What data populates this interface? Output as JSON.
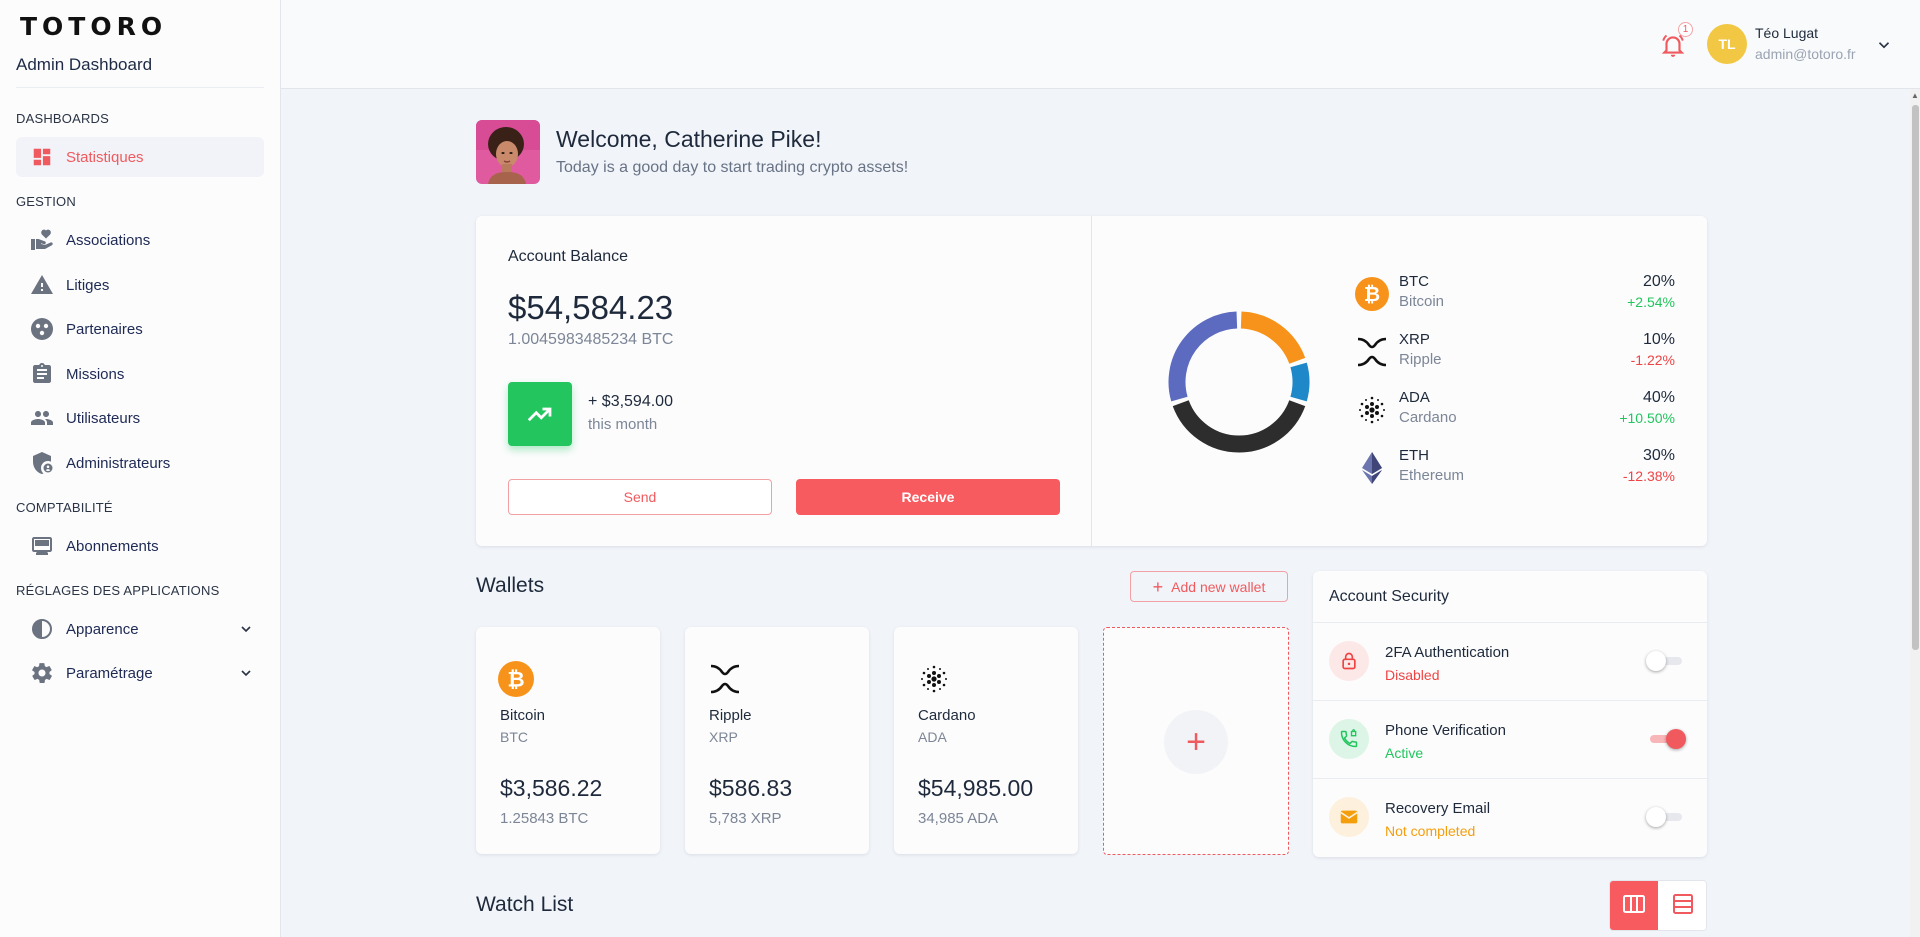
{
  "sidebar": {
    "logo": "TOTORO",
    "subtitle": "Admin Dashboard",
    "sections": {
      "dashboards": "DASHBOARDS",
      "gestion": "GESTION",
      "comptabilite": "COMPTABILITÉ",
      "reglages": "RÉGLAGES DES APPLICATIONS"
    },
    "items": {
      "statistiques": "Statistiques",
      "associations": "Associations",
      "litiges": "Litiges",
      "partenaires": "Partenaires",
      "missions": "Missions",
      "utilisateurs": "Utilisateurs",
      "administrateurs": "Administrateurs",
      "abonnements": "Abonnements",
      "apparence": "Apparence",
      "parametrage": "Paramétrage"
    }
  },
  "topbar": {
    "notification_count": "1",
    "user_initials": "TL",
    "user_name": "Téo Lugat",
    "user_email": "admin@totoro.fr"
  },
  "welcome": {
    "title": "Welcome, Catherine Pike!",
    "subtitle": "Today is a good day to start trading crypto assets!"
  },
  "balance": {
    "title": "Account Balance",
    "amount": "$54,584.23",
    "btc": "1.0045983485234 BTC",
    "change_amount": "+ $3,594.00",
    "change_label": "this month",
    "send_label": "Send",
    "receive_label": "Receive"
  },
  "portfolio": [
    {
      "symbol": "BTC",
      "name": "Bitcoin",
      "percent": "20%",
      "change": "+2.54%",
      "color": "#f7931a"
    },
    {
      "symbol": "XRP",
      "name": "Ripple",
      "percent": "10%",
      "change": "-1.22%",
      "color": "#1f88c9"
    },
    {
      "symbol": "ADA",
      "name": "Cardano",
      "percent": "40%",
      "change": "+10.50%",
      "color": "#2d2d2d"
    },
    {
      "symbol": "ETH",
      "name": "Ethereum",
      "percent": "30%",
      "change": "-12.38%",
      "color": "#5c6bc0"
    }
  ],
  "colors": {
    "accent": "#f85b5f",
    "positive": "#22c55e",
    "negative": "#ef4444",
    "warning": "#f59e0b"
  },
  "wallets": {
    "title": "Wallets",
    "add_label": "Add new wallet",
    "items": [
      {
        "name": "Bitcoin",
        "symbol": "BTC",
        "amount": "$3,586.22",
        "sub": "1.25843 BTC",
        "icon": "bitcoin-icon"
      },
      {
        "name": "Ripple",
        "symbol": "XRP",
        "amount": "$586.83",
        "sub": "5,783 XRP",
        "icon": "ripple-icon"
      },
      {
        "name": "Cardano",
        "symbol": "ADA",
        "amount": "$54,985.00",
        "sub": "34,985 ADA",
        "icon": "cardano-icon"
      }
    ]
  },
  "security": {
    "title": "Account Security",
    "items": [
      {
        "name": "2FA Authentication",
        "status": "Disabled",
        "enabled": false,
        "icon": "lock-icon"
      },
      {
        "name": "Phone Verification",
        "status": "Active",
        "enabled": true,
        "icon": "phone-icon"
      },
      {
        "name": "Recovery Email",
        "status": "Not completed",
        "enabled": false,
        "icon": "mail-icon"
      }
    ]
  },
  "watchlist": {
    "title": "Watch List"
  }
}
